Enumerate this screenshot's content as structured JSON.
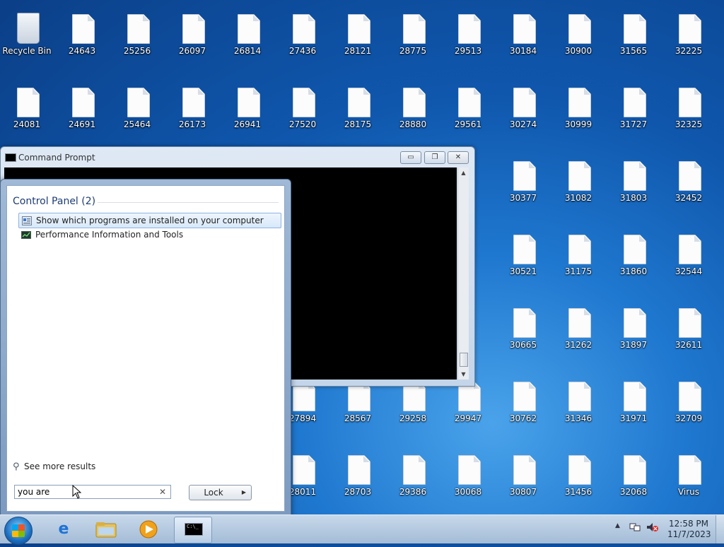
{
  "desktop": {
    "icons": [
      {
        "label": "Recycle Bin",
        "type": "recycle-bin",
        "col": 0,
        "row": 0
      },
      {
        "label": "24643",
        "col": 1,
        "row": 0
      },
      {
        "label": "25256",
        "col": 2,
        "row": 0
      },
      {
        "label": "26097",
        "col": 3,
        "row": 0
      },
      {
        "label": "26814",
        "col": 4,
        "row": 0
      },
      {
        "label": "27436",
        "col": 5,
        "row": 0
      },
      {
        "label": "28121",
        "col": 6,
        "row": 0
      },
      {
        "label": "28775",
        "col": 7,
        "row": 0
      },
      {
        "label": "29513",
        "col": 8,
        "row": 0
      },
      {
        "label": "30184",
        "col": 9,
        "row": 0
      },
      {
        "label": "30900",
        "col": 10,
        "row": 0
      },
      {
        "label": "31565",
        "col": 11,
        "row": 0
      },
      {
        "label": "32225",
        "col": 12,
        "row": 0
      },
      {
        "label": "24081",
        "col": 0,
        "row": 1
      },
      {
        "label": "24691",
        "col": 1,
        "row": 1
      },
      {
        "label": "25464",
        "col": 2,
        "row": 1
      },
      {
        "label": "26173",
        "col": 3,
        "row": 1
      },
      {
        "label": "26941",
        "col": 4,
        "row": 1
      },
      {
        "label": "27520",
        "col": 5,
        "row": 1
      },
      {
        "label": "28175",
        "col": 6,
        "row": 1
      },
      {
        "label": "28880",
        "col": 7,
        "row": 1
      },
      {
        "label": "29561",
        "col": 8,
        "row": 1
      },
      {
        "label": "30274",
        "col": 9,
        "row": 1
      },
      {
        "label": "30999",
        "col": 10,
        "row": 1
      },
      {
        "label": "31727",
        "col": 11,
        "row": 1
      },
      {
        "label": "32325",
        "col": 12,
        "row": 1
      },
      {
        "label": "30377",
        "col": 9,
        "row": 2
      },
      {
        "label": "31082",
        "col": 10,
        "row": 2
      },
      {
        "label": "31803",
        "col": 11,
        "row": 2
      },
      {
        "label": "32452",
        "col": 12,
        "row": 2
      },
      {
        "label": "30521",
        "col": 9,
        "row": 3
      },
      {
        "label": "31175",
        "col": 10,
        "row": 3
      },
      {
        "label": "31860",
        "col": 11,
        "row": 3
      },
      {
        "label": "32544",
        "col": 12,
        "row": 3
      },
      {
        "label": "30665",
        "col": 9,
        "row": 4
      },
      {
        "label": "31262",
        "col": 10,
        "row": 4
      },
      {
        "label": "31897",
        "col": 11,
        "row": 4
      },
      {
        "label": "32611",
        "col": 12,
        "row": 4
      },
      {
        "label": "27894",
        "col": 5,
        "row": 5
      },
      {
        "label": "28567",
        "col": 6,
        "row": 5
      },
      {
        "label": "29258",
        "col": 7,
        "row": 5
      },
      {
        "label": "29947",
        "col": 8,
        "row": 5
      },
      {
        "label": "30762",
        "col": 9,
        "row": 5
      },
      {
        "label": "31346",
        "col": 10,
        "row": 5
      },
      {
        "label": "31971",
        "col": 11,
        "row": 5
      },
      {
        "label": "32709",
        "col": 12,
        "row": 5
      },
      {
        "label": "28011",
        "col": 5,
        "row": 6
      },
      {
        "label": "28703",
        "col": 6,
        "row": 6
      },
      {
        "label": "29386",
        "col": 7,
        "row": 6
      },
      {
        "label": "30068",
        "col": 8,
        "row": 6
      },
      {
        "label": "30807",
        "col": 9,
        "row": 6
      },
      {
        "label": "31456",
        "col": 10,
        "row": 6
      },
      {
        "label": "32068",
        "col": 11,
        "row": 6
      },
      {
        "label": "Virus",
        "col": 12,
        "row": 6
      }
    ]
  },
  "cmd_window": {
    "title": "Command Prompt",
    "minimize": "▭",
    "restore": "❐",
    "close": "✕",
    "console_text": ""
  },
  "start_menu": {
    "section_title": "Control Panel (2)",
    "results": [
      {
        "label": "Show which programs are installed on your computer",
        "icon": "programs-icon",
        "selected": true
      },
      {
        "label": "Performance Information and Tools",
        "icon": "performance-icon",
        "selected": false
      }
    ],
    "see_more": "See more results",
    "search": {
      "value": "you are",
      "placeholder": ""
    },
    "clear": "✕",
    "lock_label": "Lock",
    "lock_arrow": "▶"
  },
  "taskbar": {
    "pinned": [
      "internet-explorer-icon",
      "windows-explorer-icon",
      "media-player-icon",
      "command-prompt-icon"
    ],
    "clock_time": "12:58 PM",
    "clock_date": "11/7/2023",
    "tray": [
      "show-hidden-icons-arrow",
      "network-icon",
      "volume-muted-icon"
    ]
  },
  "colors": {
    "selection": "#d8e8f9",
    "title_text": "#1e3d75"
  }
}
